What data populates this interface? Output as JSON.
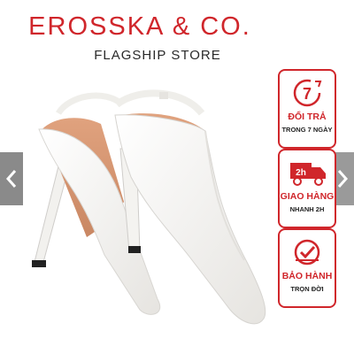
{
  "header": {
    "brand": "EROSSKA & CO.",
    "subtitle": "FLAGSHIP STORE"
  },
  "badges": [
    {
      "icon": "return-7-days-icon",
      "title": "ĐỔI TRẢ",
      "subtitle": "TRONG 7 NGÀY"
    },
    {
      "icon": "delivery-truck-icon",
      "title": "GIAO HÀNG",
      "subtitle": "NHANH 2H"
    },
    {
      "icon": "warranty-check-icon",
      "title": "BẢO HÀNH",
      "subtitle": "TRỌN ĐỜI"
    }
  ],
  "nav": {
    "prev_icon": "chevron-left-icon",
    "next_icon": "chevron-right-icon"
  },
  "product_image": {
    "icon": "white-slingback-pumps-image"
  },
  "colors": {
    "brand_red": "#d0262b",
    "arrow_gray": "#8a8a8a"
  }
}
